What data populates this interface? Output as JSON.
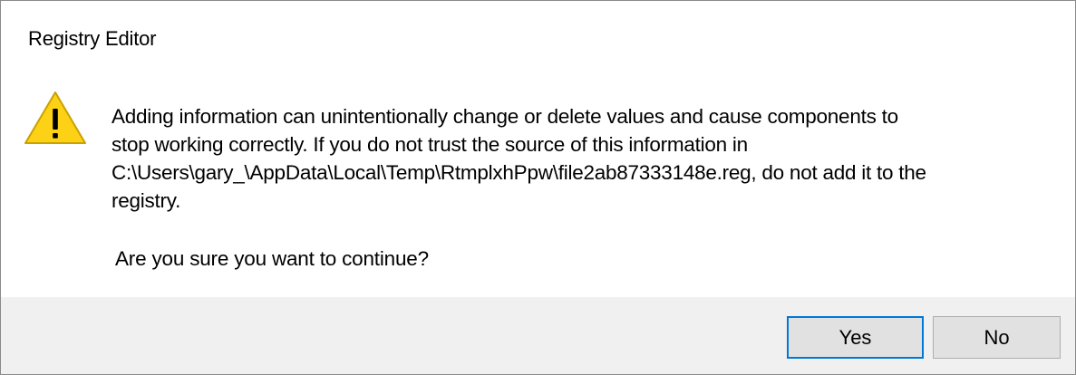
{
  "dialog": {
    "title": "Registry Editor",
    "icon": "warning-triangle-icon",
    "message_lines": [
      "Adding information can unintentionally change or delete values and cause components to",
      "stop working correctly. If you do not trust the source of this information in",
      "C:\\Users\\gary_\\AppData\\Local\\Temp\\RtmplxhPpw\\file2ab87333148e.reg, do not add it to the",
      "registry."
    ],
    "question": "Are you sure you want to continue?",
    "buttons": {
      "yes": "Yes",
      "no": "No"
    },
    "colors": {
      "warning_fill": "#fcd116",
      "default_button_border": "#0078d7",
      "footer_bg": "#f0f0f0"
    }
  }
}
